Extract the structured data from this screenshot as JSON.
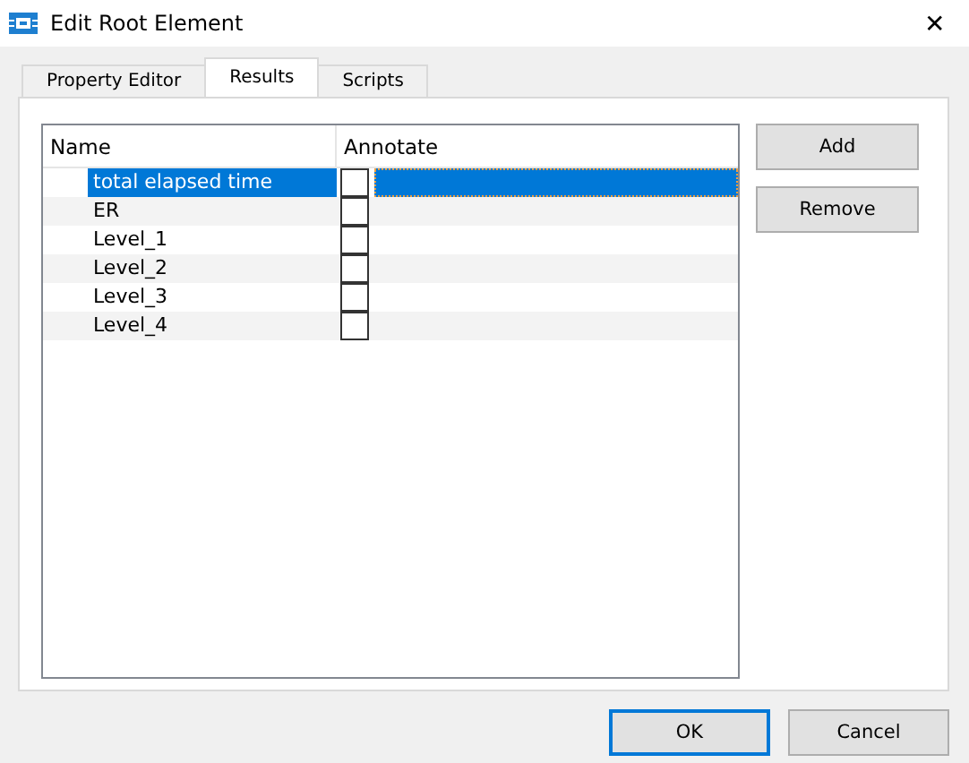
{
  "window": {
    "title": "Edit Root Element",
    "close": "✕"
  },
  "tabs": [
    {
      "label": "Property Editor",
      "selected": false
    },
    {
      "label": "Results",
      "selected": true
    },
    {
      "label": "Scripts",
      "selected": false
    }
  ],
  "table": {
    "columns": [
      "Name",
      "Annotate"
    ],
    "rows": [
      {
        "name": "total elapsed time",
        "annotate": false,
        "selected": true
      },
      {
        "name": "ER",
        "annotate": false,
        "selected": false
      },
      {
        "name": "Level_1",
        "annotate": false,
        "selected": false
      },
      {
        "name": "Level_2",
        "annotate": false,
        "selected": false
      },
      {
        "name": "Level_3",
        "annotate": false,
        "selected": false
      },
      {
        "name": "Level_4",
        "annotate": false,
        "selected": false
      }
    ]
  },
  "side_buttons": [
    "Add",
    "Remove"
  ],
  "footer_buttons": [
    {
      "label": "OK",
      "default": true
    },
    {
      "label": "Cancel",
      "default": false
    }
  ]
}
